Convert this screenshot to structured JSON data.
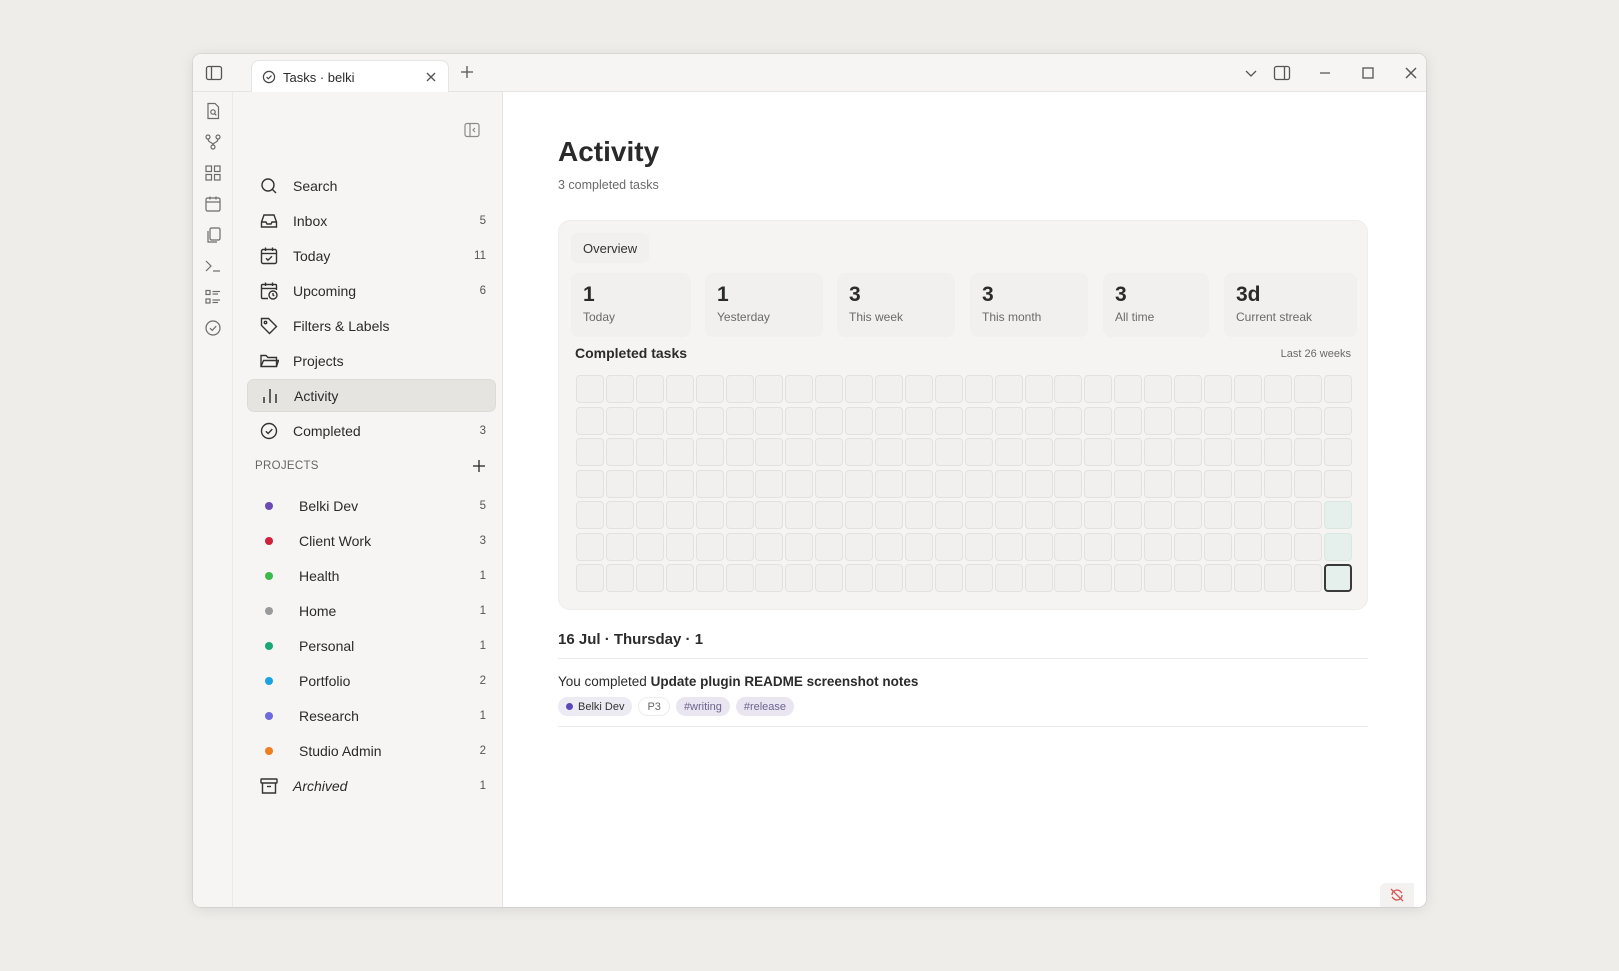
{
  "titlebar": {
    "tab_label": "Tasks · belki",
    "icons": [
      "sidebar-toggle-icon",
      "check-circle-icon",
      "close-icon",
      "plus-icon",
      "chevron-down-icon",
      "split-pane-icon",
      "minimize-icon",
      "maximize-icon",
      "close-icon"
    ]
  },
  "ribbon": {
    "icons": [
      "file-search-icon",
      "git-branch-icon",
      "grid-icon",
      "calendar-icon",
      "copy-icon",
      "terminal-icon",
      "list-icon",
      "check-circle-icon"
    ]
  },
  "sidebar": {
    "nav": [
      {
        "label": "Search",
        "count": "",
        "icon": "search-icon"
      },
      {
        "label": "Inbox",
        "count": "5",
        "icon": "inbox-icon"
      },
      {
        "label": "Today",
        "count": "11",
        "icon": "calendar-check-icon"
      },
      {
        "label": "Upcoming",
        "count": "6",
        "icon": "calendar-clock-icon"
      },
      {
        "label": "Filters & Labels",
        "count": "",
        "icon": "tag-icon"
      },
      {
        "label": "Projects",
        "count": "",
        "icon": "folder-icon"
      },
      {
        "label": "Activity",
        "count": "",
        "icon": "bar-chart-icon"
      },
      {
        "label": "Completed",
        "count": "3",
        "icon": "check-circle-icon"
      }
    ],
    "projects_heading": "PROJECTS",
    "projects": [
      {
        "label": "Belki Dev",
        "count": "5",
        "color": "#6a4bb5"
      },
      {
        "label": "Client Work",
        "count": "3",
        "color": "#d0213b"
      },
      {
        "label": "Health",
        "count": "1",
        "color": "#3cb94c"
      },
      {
        "label": "Home",
        "count": "1",
        "color": "#9a9a9a"
      },
      {
        "label": "Personal",
        "count": "1",
        "color": "#1aa876"
      },
      {
        "label": "Portfolio",
        "count": "2",
        "color": "#1aa3e0"
      },
      {
        "label": "Research",
        "count": "1",
        "color": "#6d6ade"
      },
      {
        "label": "Studio Admin",
        "count": "2",
        "color": "#ef7d22"
      }
    ],
    "archived": {
      "label": "Archived",
      "count": "1"
    }
  },
  "main": {
    "title": "Activity",
    "subtitle": "3 completed tasks",
    "overview": {
      "label": "Overview",
      "stats": [
        {
          "value": "1",
          "label": "Today"
        },
        {
          "value": "1",
          "label": "Yesterday"
        },
        {
          "value": "3",
          "label": "This week"
        },
        {
          "value": "3",
          "label": "This month"
        },
        {
          "value": "3",
          "label": "All time"
        },
        {
          "value": "3d",
          "label": "Current streak"
        }
      ],
      "completed_title": "Completed tasks",
      "range_label": "Last 26 weeks",
      "heatmap": {
        "weeks": 26,
        "days": 7,
        "active_cells": [
          [
            25,
            4,
            1
          ],
          [
            25,
            5,
            1
          ],
          [
            25,
            6,
            1
          ]
        ],
        "today_cell": [
          25,
          6
        ]
      }
    },
    "day_heading": "16 Jul · Thursday · 1",
    "entry": {
      "prefix": "You completed",
      "task": "Update plugin README screenshot notes",
      "project_tag": "Belki Dev",
      "project_color": "#5c47b8",
      "priority": "P3",
      "tags": [
        "#writing",
        "#release"
      ]
    }
  },
  "status_icon": "sync-off-icon"
}
